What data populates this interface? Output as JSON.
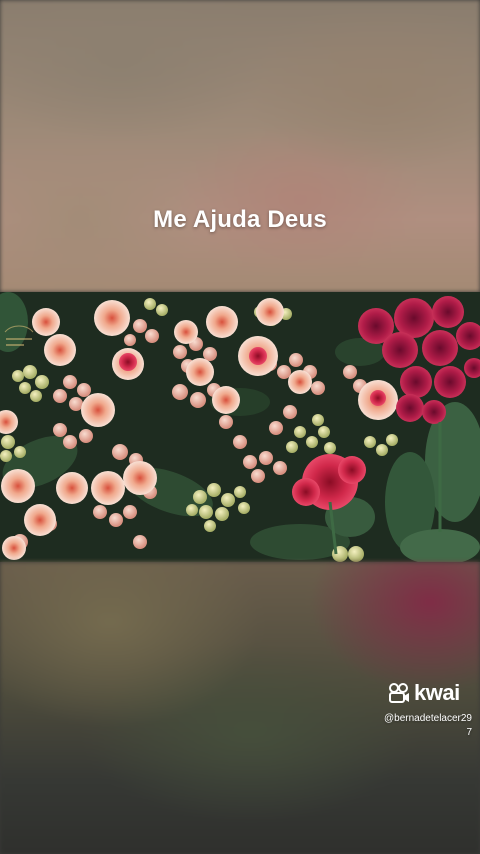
{
  "video": {
    "caption": "Me Ajuda Deus",
    "photo_description_icon": "kalanchoe-flowers-image"
  },
  "overlay": {
    "brand": "kwai",
    "brand_icon": "kwai-logo-icon",
    "username_line1": "@bernadetelacer29",
    "username_line2": "7"
  },
  "colors": {
    "caption_text": "#ffffff",
    "flower_pink": "#e8a090",
    "flower_red": "#c8283c",
    "flower_magenta": "#a01848",
    "bud_green": "#c8d088",
    "leaf_green": "#2e4a30"
  }
}
